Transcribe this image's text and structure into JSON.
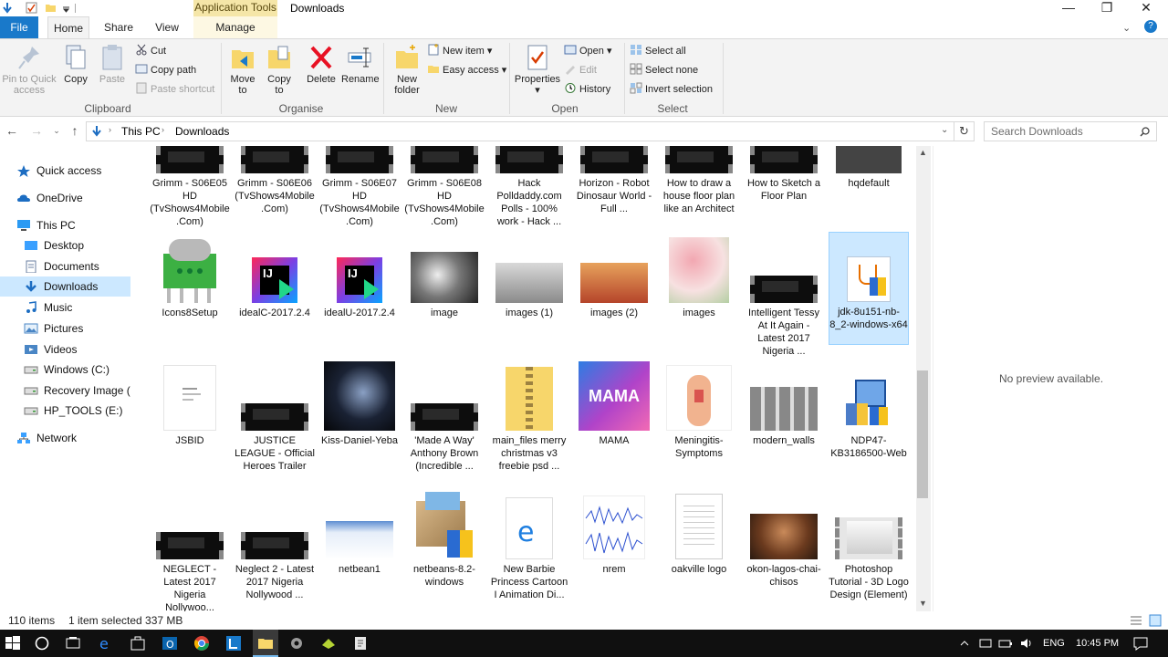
{
  "window": {
    "title": "Downloads",
    "contextual_header": "Application Tools"
  },
  "ribbon": {
    "tabs": [
      "File",
      "Home",
      "Share",
      "View",
      "Manage"
    ],
    "clipboard": {
      "pin": "Pin to Quick access",
      "copy": "Copy",
      "paste": "Paste",
      "cut": "Cut",
      "copy_path": "Copy path",
      "paste_shortcut": "Paste shortcut",
      "label": "Clipboard"
    },
    "organise": {
      "move_to": "Move to",
      "copy_to": "Copy to",
      "delete": "Delete",
      "rename": "Rename",
      "label": "Organise"
    },
    "new": {
      "new_folder": "New folder",
      "new_item": "New item",
      "easy_access": "Easy access",
      "label": "New"
    },
    "open": {
      "properties": "Properties",
      "open": "Open",
      "edit": "Edit",
      "history": "History",
      "label": "Open"
    },
    "select": {
      "select_all": "Select all",
      "select_none": "Select none",
      "invert": "Invert selection",
      "label": "Select"
    }
  },
  "address": {
    "path": [
      "This PC",
      "Downloads"
    ],
    "search_placeholder": "Search Downloads"
  },
  "nav": [
    {
      "label": "Quick access",
      "icon": "star-icon"
    },
    {
      "label": "OneDrive",
      "icon": "cloud-icon"
    },
    {
      "label": "This PC",
      "icon": "computer-icon"
    },
    {
      "label": "Desktop",
      "icon": "desktop-icon"
    },
    {
      "label": "Documents",
      "icon": "documents-icon"
    },
    {
      "label": "Downloads",
      "icon": "download-icon"
    },
    {
      "label": "Music",
      "icon": "music-icon"
    },
    {
      "label": "Pictures",
      "icon": "pictures-icon"
    },
    {
      "label": "Videos",
      "icon": "videos-icon"
    },
    {
      "label": "Windows (C:)",
      "icon": "drive-icon"
    },
    {
      "label": "Recovery Image (D:",
      "icon": "drive-icon"
    },
    {
      "label": "HP_TOOLS (E:)",
      "icon": "drive-icon"
    },
    {
      "label": "Network",
      "icon": "network-icon"
    }
  ],
  "files": [
    {
      "name": "Grimm - S06E05 HD (TvShows4Mobile.Com)",
      "kind": "video"
    },
    {
      "name": "Grimm - S06E06 (TvShows4Mobile.Com)",
      "kind": "video"
    },
    {
      "name": "Grimm - S06E07 HD (TvShows4Mobile.Com)",
      "kind": "video"
    },
    {
      "name": "Grimm - S06E08 HD (TvShows4Mobile.Com)",
      "kind": "video"
    },
    {
      "name": "Hack Polldaddy.com Polls - 100% work - Hack ...",
      "kind": "video"
    },
    {
      "name": "Horizon - Robot Dinosaur World - Full ...",
      "kind": "video"
    },
    {
      "name": "How to draw a house floor plan like an Architect",
      "kind": "video"
    },
    {
      "name": "How to Sketch a Floor Plan",
      "kind": "video"
    },
    {
      "name": "hqdefault",
      "kind": "image"
    },
    {
      "name": "Icons8Setup",
      "kind": "app-green"
    },
    {
      "name": "idealC-2017.2.4",
      "kind": "app-ij"
    },
    {
      "name": "idealU-2017.2.4",
      "kind": "app-ij"
    },
    {
      "name": "image",
      "kind": "image-gray"
    },
    {
      "name": "images (1)",
      "kind": "image-boxes"
    },
    {
      "name": "images (2)",
      "kind": "image-food"
    },
    {
      "name": "images",
      "kind": "image-flowers"
    },
    {
      "name": "Intelligent Tessy At It Again -  Latest 2017 Nigeria ...",
      "kind": "video"
    },
    {
      "name": "jdk-8u151-nb-8_2-windows-x64",
      "kind": "app-java"
    },
    {
      "name": "JSBID",
      "kind": "doc"
    },
    {
      "name": "JUSTICE LEAGUE - Official Heroes Trailer",
      "kind": "video"
    },
    {
      "name": "Kiss-Daniel-Yeba",
      "kind": "image-dark"
    },
    {
      "name": "'Made A Way' Anthony Brown (Incredible ...",
      "kind": "video"
    },
    {
      "name": "main_files merry christmas v3 freebie psd ...",
      "kind": "zip"
    },
    {
      "name": "MAMA",
      "kind": "image-mama"
    },
    {
      "name": "Meningitis-Symptoms",
      "kind": "image-body"
    },
    {
      "name": "modern_walls",
      "kind": "image-walls"
    },
    {
      "name": "NDP47-KB3186500-Web",
      "kind": "app-setup"
    },
    {
      "name": "NEGLECT - Latest 2017 Nigeria Nollywoo...",
      "kind": "video"
    },
    {
      "name": "Neglect 2 - Latest 2017 Nigeria Nollywood ...",
      "kind": "video"
    },
    {
      "name": "netbean1",
      "kind": "image-screen"
    },
    {
      "name": "netbeans-8.2-windows",
      "kind": "app-box"
    },
    {
      "name": "New Barbie Princess Cartoon I Animation Di...",
      "kind": "app-edge"
    },
    {
      "name": "nrem",
      "kind": "image-wave"
    },
    {
      "name": "oakville logo",
      "kind": "doc-blank"
    },
    {
      "name": "okon-lagos-chai-chisos",
      "kind": "image-face"
    },
    {
      "name": "Photoshop Tutorial - 3D Logo Design (Element)",
      "kind": "video-light"
    }
  ],
  "preview_text": "No preview available.",
  "status": {
    "count": "110 items",
    "selection": "1 item selected  337 MB"
  },
  "taskbar": {
    "language": "ENG",
    "time": "10:45 PM"
  },
  "colors": {
    "accent": "#1979ca",
    "selection": "#cce8ff",
    "ribbon_bg": "#f3f3f3",
    "taskbar": "#101010"
  }
}
